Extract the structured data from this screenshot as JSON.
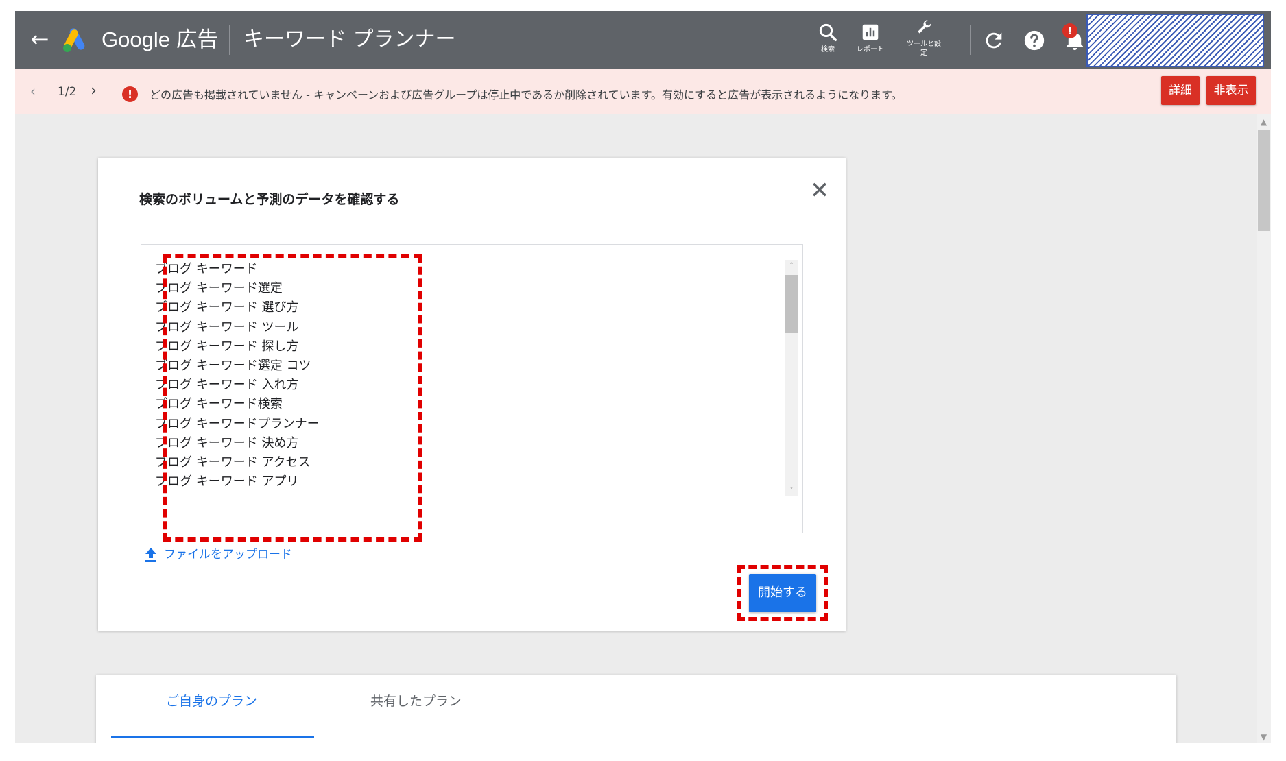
{
  "header": {
    "back_icon": "arrow-left-icon",
    "logo_icon": "google-ads-logo",
    "brand": "Google 広告",
    "title": "キーワード プランナー",
    "tools": [
      {
        "label": "検索",
        "icon": "search-icon"
      },
      {
        "label": "レポート",
        "icon": "bar-chart-icon"
      },
      {
        "label": "ツールと設定",
        "icon": "wrench-icon"
      }
    ],
    "right_icons": [
      "refresh-icon",
      "help-icon",
      "bell-icon"
    ],
    "notification_badge": "!",
    "colors": {
      "header_bg": "#5f6368",
      "account_stripe": "#3b5bb5"
    }
  },
  "alert": {
    "pager": "1/2",
    "icon": "!",
    "message": "どの広告も掲載されていません - キャンペーンおよび広告グループは停止中であるか削除されています。有効にすると広告が表示されるようになります。",
    "details_label": "詳細",
    "hide_label": "非表示",
    "colors": {
      "bg": "#fce8e6",
      "button": "#d93025"
    }
  },
  "dialog": {
    "title": "検索のボリュームと予測のデータを確認する",
    "close_icon": "close-icon",
    "keywords": [
      "ブログ キーワード",
      "ブログ キーワード選定",
      "ブログ キーワード 選び方",
      "ブログ キーワード ツール",
      "ブログ キーワード 探し方",
      "ブログ キーワード選定 コツ",
      "ブログ キーワード 入れ方",
      "ブログ キーワード検索",
      "ブログ キーワードプランナー",
      "ブログ キーワード 決め方",
      "ブログ キーワード アクセス",
      "ブログ キーワード アプリ"
    ],
    "upload_label": "ファイルをアップロード",
    "upload_icon": "upload-icon",
    "start_label": "開始する",
    "colors": {
      "primary": "#1a73e8",
      "highlight": "#e00000"
    }
  },
  "plans": {
    "tabs": [
      {
        "label": "ご自身のプラン",
        "active": true
      },
      {
        "label": "共有したプラン",
        "active": false
      }
    ],
    "more_icon": "more-icon"
  }
}
